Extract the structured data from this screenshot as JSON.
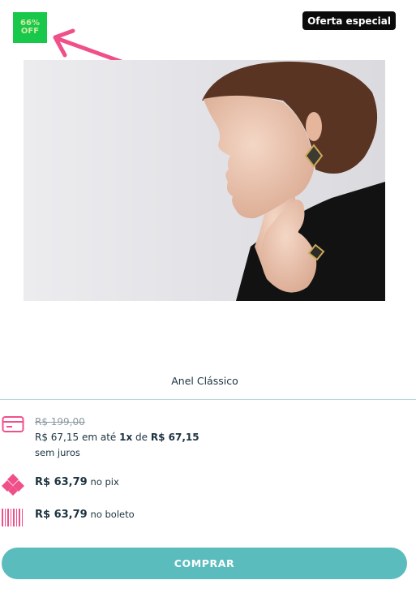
{
  "badges": {
    "discount_line1": "66%",
    "discount_line2": "OFF",
    "offer": "Oferta especial"
  },
  "product": {
    "name": "Anel Clássico"
  },
  "pricing": {
    "original_price": "R$ 199,00",
    "card_price": "R$ 67,15",
    "card_installment_prefix": "em até",
    "installments": "1x",
    "installment_mid": "de",
    "installment_value": "R$ 67,15",
    "card_suffix": "sem juros",
    "pix_price": "R$ 63,79",
    "pix_label": "no pix",
    "boleto_price": "R$ 63,79",
    "boleto_label": "no boleto"
  },
  "actions": {
    "buy_label": "COMPRAR"
  },
  "colors": {
    "accent": "#5bbcbd",
    "discount": "#18c84a",
    "icon_pink": "#f0508a",
    "text_dark": "#1c3340"
  },
  "icons": [
    "credit-card-icon",
    "pix-icon",
    "barcode-icon",
    "arrow-annotation-icon"
  ]
}
